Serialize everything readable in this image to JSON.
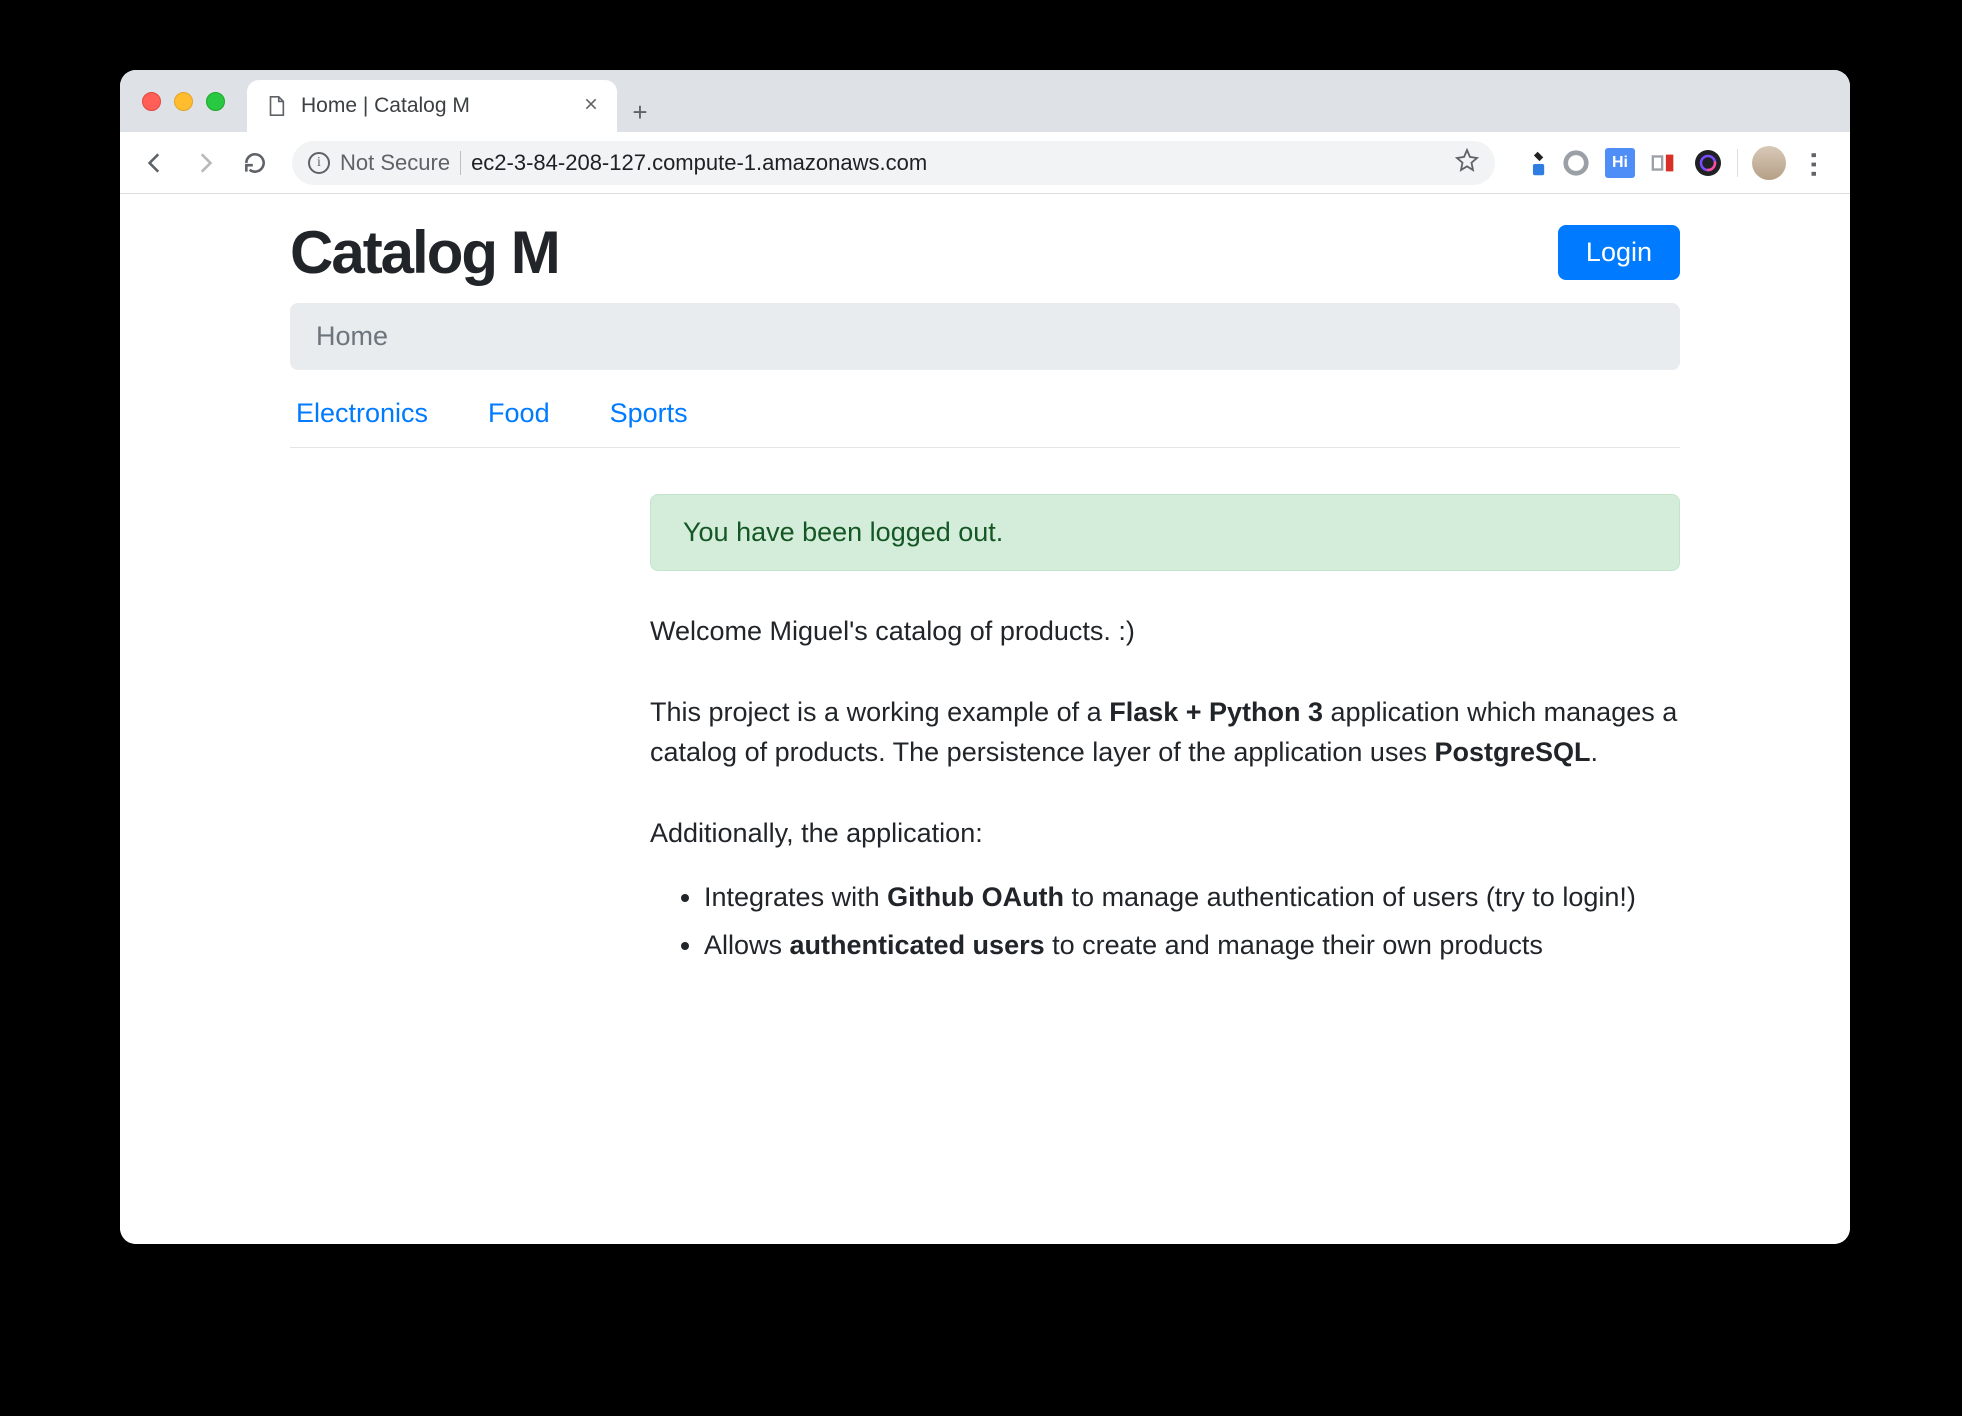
{
  "browser": {
    "tab_title": "Home | Catalog M",
    "security_label": "Not Secure",
    "url": "ec2-3-84-208-127.compute-1.amazonaws.com"
  },
  "header": {
    "brand": "Catalog M",
    "login_label": "Login"
  },
  "breadcrumb": {
    "current": "Home"
  },
  "categories": [
    "Electronics",
    "Food",
    "Sports"
  ],
  "alert": {
    "message": "You have been logged out."
  },
  "content": {
    "welcome": "Welcome Miguel's catalog of products. :)",
    "desc_pre": "This project is a working example of a ",
    "desc_tech1": "Flask + Python 3",
    "desc_mid": " application which manages a catalog of products. The persistence layer of the application uses ",
    "desc_tech2": "PostgreSQL",
    "desc_post": ".",
    "additional_label": "Additionally, the application:",
    "features": [
      {
        "pre": "Integrates with ",
        "bold": "Github OAuth",
        "post": " to manage authentication of users (try to login!)"
      },
      {
        "pre": "Allows ",
        "bold": "authenticated users",
        "post": " to create and manage their own products"
      }
    ]
  }
}
